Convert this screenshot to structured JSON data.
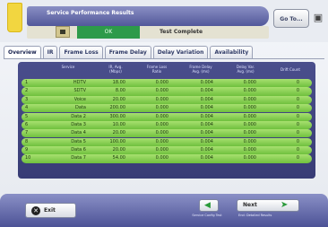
{
  "header": {
    "title": "Service Performance Results",
    "ok_label": "OK",
    "status_text": "Test Complete",
    "goto_label": "Go To...",
    "camera_icon": "camera-icon",
    "save_icon": "save-icon"
  },
  "tabs": [
    {
      "label": "Overview",
      "active": true
    },
    {
      "label": "IR",
      "active": false
    },
    {
      "label": "Frame Loss",
      "active": false
    },
    {
      "label": "Frame Delay",
      "active": false
    },
    {
      "label": "Delay Variation",
      "active": false
    },
    {
      "label": "Availability",
      "active": false
    }
  ],
  "table": {
    "columns": [
      {
        "label": ""
      },
      {
        "label": "Service"
      },
      {
        "label": "IR, Avg.\n(Mbps)"
      },
      {
        "label": "Frame Loss\nRatio"
      },
      {
        "label": "Frame Delay\nAvg. (ms)"
      },
      {
        "label": "Delay Var.\nAvg. (ms)"
      },
      {
        "label": "Drift Count"
      }
    ],
    "rows": [
      {
        "id": "1",
        "service": "HDTV",
        "ir": "18.00",
        "loss": "0.000",
        "delay": "0.004",
        "var": "0.000",
        "drift": "0"
      },
      {
        "id": "2",
        "service": "SDTV",
        "ir": "8.00",
        "loss": "0.000",
        "delay": "0.004",
        "var": "0.000",
        "drift": "0"
      },
      {
        "id": "3",
        "service": "Voice",
        "ir": "20.00",
        "loss": "0.000",
        "delay": "0.004",
        "var": "0.000",
        "drift": "0"
      },
      {
        "id": "4",
        "service": "Data",
        "ir": "200.00",
        "loss": "0.000",
        "delay": "0.004",
        "var": "0.000",
        "drift": "0"
      },
      {
        "id": "5",
        "service": "Data 2",
        "ir": "300.00",
        "loss": "0.000",
        "delay": "0.004",
        "var": "0.000",
        "drift": "0"
      },
      {
        "id": "6",
        "service": "Data 3",
        "ir": "10.00",
        "loss": "0.000",
        "delay": "0.004",
        "var": "0.000",
        "drift": "0"
      },
      {
        "id": "7",
        "service": "Data 4",
        "ir": "20.00",
        "loss": "0.000",
        "delay": "0.004",
        "var": "0.000",
        "drift": "0"
      },
      {
        "id": "8",
        "service": "Data 5",
        "ir": "100.00",
        "loss": "0.000",
        "delay": "0.004",
        "var": "0.000",
        "drift": "0"
      },
      {
        "id": "9",
        "service": "Data 6",
        "ir": "20.00",
        "loss": "0.000",
        "delay": "0.004",
        "var": "0.000",
        "drift": "0"
      },
      {
        "id": "10",
        "service": "Data 7",
        "ir": "54.00",
        "loss": "0.000",
        "delay": "0.004",
        "var": "0.000",
        "drift": "0"
      }
    ]
  },
  "footer": {
    "exit_label": "Exit",
    "exit_icon": "close-icon",
    "back_icon": "arrow-left-icon",
    "back_caption": "Service Config Test",
    "next_label": "Next",
    "next_icon": "arrow-right-icon",
    "next_caption": "End: Detailed Results"
  },
  "colors": {
    "header_bar": "#52589a",
    "ok_green": "#2d9a4a",
    "row_green": "#6fc03e",
    "table_bg": "#383c76"
  }
}
